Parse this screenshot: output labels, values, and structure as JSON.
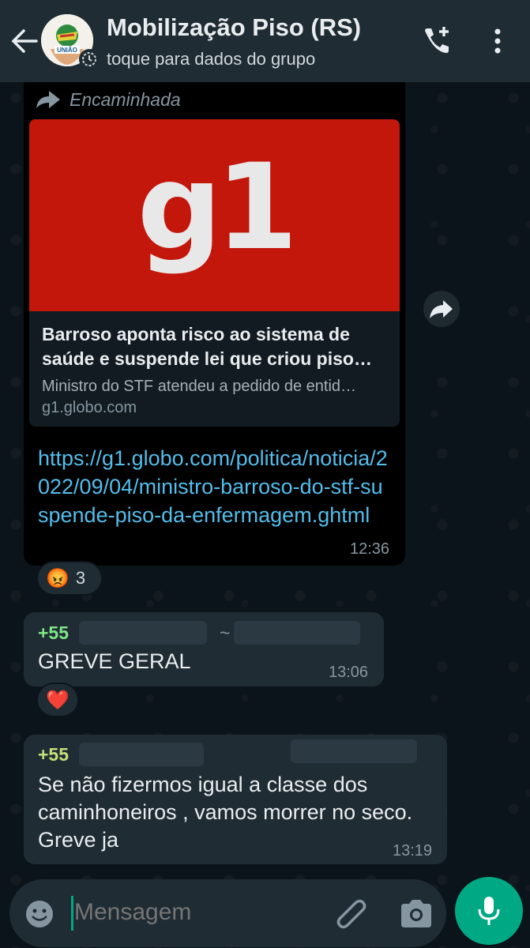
{
  "header": {
    "title": "Mobilização Piso (RS)",
    "subtitle": "toque para dados do grupo",
    "avatar_text": "UNIÃO"
  },
  "forwarded_message": {
    "forwarded_label": "Encaminhada",
    "preview_logo": "g1",
    "preview_title": "Barroso aponta risco ao sistema de saúde e suspende lei que criou piso…",
    "preview_description": "Ministro do STF atendeu a pedido de entid…",
    "preview_domain": "g1.globo.com",
    "link": "https://g1.globo.com/politica/noticia/2022/09/04/ministro-barroso-do-stf-suspende-piso-da-enfermagem.ghtml",
    "time": "12:36",
    "reaction_emoji": "😡",
    "reaction_count": "3"
  },
  "message_2": {
    "sender_prefix": "+55",
    "sender_separator": "~",
    "text": "GREVE GERAL",
    "time": "13:06",
    "reaction_emoji": "❤️"
  },
  "message_3": {
    "sender_prefix": "+55",
    "text": "Se não fizermos igual a classe dos caminhoneiros , vamos morrer no seco. Greve ja",
    "time": "13:19"
  },
  "input": {
    "placeholder": "Mensagem"
  },
  "colors": {
    "header_bg": "#1f2c34",
    "chat_bg": "#0b141a",
    "incoming_bubble": "#202c33",
    "link": "#53bdeb",
    "accent": "#00a884",
    "g1_red": "#c4170c",
    "sender_green": "#7ee787",
    "sender_yellowgreen": "#c6e07a"
  },
  "icons": [
    "back-arrow-icon",
    "group-status-icon",
    "add-call-icon",
    "more-vert-icon",
    "forward-icon",
    "share-icon",
    "emoji-icon",
    "attach-icon",
    "camera-icon",
    "mic-icon"
  ]
}
